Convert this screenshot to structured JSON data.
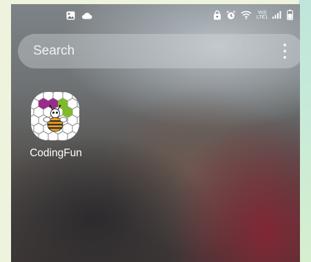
{
  "status_bar": {
    "left_icons": [
      "gallery-icon",
      "cloud-icon"
    ],
    "right_icons": [
      "lock-icon",
      "alarm-icon",
      "wifi-icon",
      "volte-lte-icon",
      "signal-icon",
      "battery-icon"
    ],
    "volte_top": "Vo))",
    "volte_bottom": "LTE1"
  },
  "search": {
    "placeholder": "Search",
    "menu_icon": "more-vertical-icon"
  },
  "apps": [
    {
      "label": "CodingFun",
      "icon": "coding-fun-bee-hexagon-icon"
    }
  ],
  "colors": {
    "text": "#ffffff",
    "search_bg": "rgba(215,220,224,0.38)",
    "hex_purple": "#9a2d8c",
    "hex_green": "#7dbb2a",
    "bee_orange": "#f2a21c"
  }
}
